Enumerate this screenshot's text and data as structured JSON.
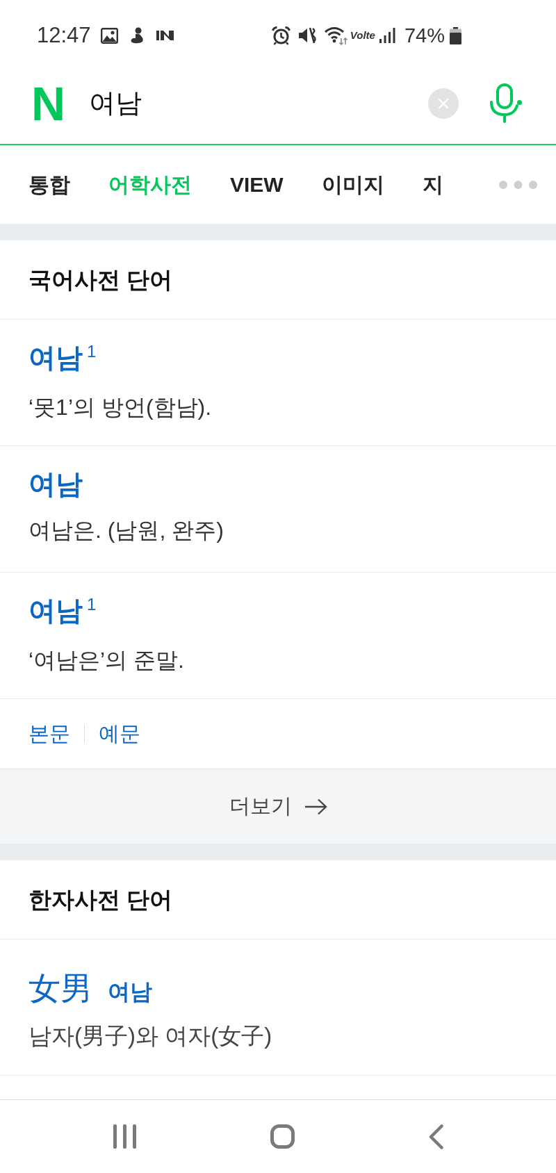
{
  "status_bar": {
    "time": "12:47",
    "network_label": "Volte",
    "battery": "74%"
  },
  "search_bar": {
    "logo": "N",
    "query": "여남"
  },
  "tabs": [
    {
      "label": "통합",
      "selected": false
    },
    {
      "label": "어학사전",
      "selected": true
    },
    {
      "label": "VIEW",
      "selected": false
    },
    {
      "label": "이미지",
      "selected": false
    },
    {
      "label": "지",
      "selected": false
    }
  ],
  "sections": [
    {
      "title": "국어사전 단어",
      "entries": [
        {
          "kind": "word",
          "headword": "여남$^{1}$",
          "definition": "‘못1’의 방언(함남)."
        },
        {
          "kind": "word",
          "headword": "여남",
          "definition": "여남은. (남원, 완주)"
        },
        {
          "kind": "word",
          "headword": "여남$^{1}$",
          "definition": "‘여남은’의 준말."
        }
      ],
      "links": [
        "본문",
        "예문"
      ],
      "more_button": "더보기"
    },
    {
      "title": "한자사전 단어",
      "entries": [
        {
          "kind": "hanja",
          "headword": "女男",
          "reading": "여남",
          "definition": "남자(男子)와 여자(女子)"
        }
      ]
    }
  ]
}
